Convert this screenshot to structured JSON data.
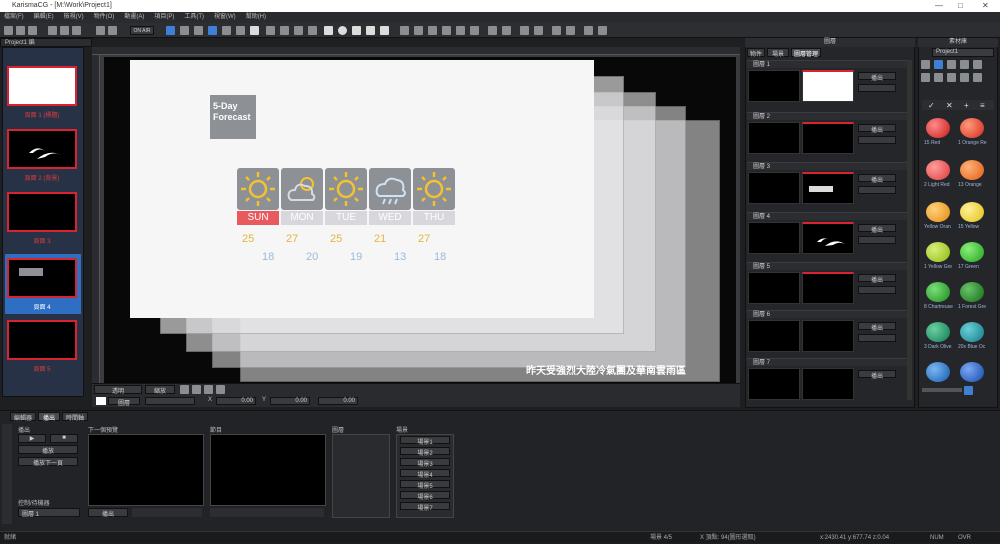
{
  "titlebar": {
    "title": "KarismaCG - [M:\\Work\\Project1]",
    "minimize": "—",
    "maximize": "□",
    "close": "✕"
  },
  "menu": [
    "檔案(F)",
    "編輯(E)",
    "檢視(V)",
    "物件(O)",
    "動畫(A)",
    "項目(P)",
    "工具(T)",
    "視窗(W)",
    "幫助(H)"
  ],
  "toolbar": {
    "zoom_label": "ON AIR"
  },
  "project_tab": "Project1 編",
  "slides": [
    {
      "label": "頁面 1 (標題)"
    },
    {
      "label": "頁面 2 (背景)"
    },
    {
      "label": "頁面 3"
    },
    {
      "label": "頁面 4"
    },
    {
      "label": "頁面 5"
    }
  ],
  "canvas": {
    "forecast_title": "5-Day\nForecast",
    "days": [
      {
        "name": "SUN",
        "hi": "25",
        "lo": "18",
        "icon": "sun-icon"
      },
      {
        "name": "MON",
        "hi": "27",
        "lo": "20",
        "icon": "partly-cloudy-icon"
      },
      {
        "name": "TUE",
        "hi": "25",
        "lo": "19",
        "icon": "sun-icon"
      },
      {
        "name": "WED",
        "hi": "21",
        "lo": "13",
        "icon": "rain-cloud-icon"
      },
      {
        "name": "THU",
        "hi": "27",
        "lo": "18",
        "icon": "sun-icon"
      }
    ],
    "ticker": "昨天受強烈大陸冷氣團及華南雲雨區"
  },
  "canvas_toolbar": {
    "mode": "透明",
    "zoom": "縮放",
    "layer": "圖層",
    "x_label": "X",
    "x_value": "0.00",
    "y_label": "Y",
    "y_value": "0.00",
    "z_value": "0.00"
  },
  "right_panel": {
    "title": "圖層",
    "tabs": [
      "物件",
      "場景",
      "圖層管理"
    ],
    "rows": [
      "圖層 1",
      "圖層 2",
      "圖層 3",
      "圖層 4",
      "圖層 5",
      "圖層 6",
      "圖層 7"
    ],
    "row_dropdown": "播出"
  },
  "library": {
    "title": "素材庫",
    "select": "Project1",
    "items": [
      "15 Red",
      "1 Orange Re",
      "2 Light Red",
      "13 Orange",
      "Yellow Oran",
      "15 Yellow",
      "1 Yellow Gre",
      "17 Green",
      "8 Chartreuse",
      "1 Forest Gre",
      "3 Dark Olive",
      "20x Blue Oc",
      "",
      ""
    ]
  },
  "bottom": {
    "tabs": [
      "編輯器",
      "播出",
      "時間軸"
    ],
    "section_title": "播出",
    "play": "播放",
    "stop": "停止",
    "next": "播放下一頁",
    "cue_label": "控制/待機器",
    "cue_select": "圖層 1",
    "preview_title": "下一個預覽",
    "program_title": "節目",
    "layer_list_title": "圖層",
    "scene_list_title": "場景",
    "preview_dropdown": "播出",
    "scene_buttons": [
      "場景1",
      "場景2",
      "場景3",
      "場景4",
      "場景5",
      "場景6",
      "場景7"
    ]
  },
  "status": {
    "left": "就緒",
    "page": "場景 4/5",
    "msg": "X 頂點: 94(圖形選取)",
    "coords": "x:2430.41 y:677.74 z:0.04",
    "num": "NUM",
    "ovr": "OVR"
  }
}
